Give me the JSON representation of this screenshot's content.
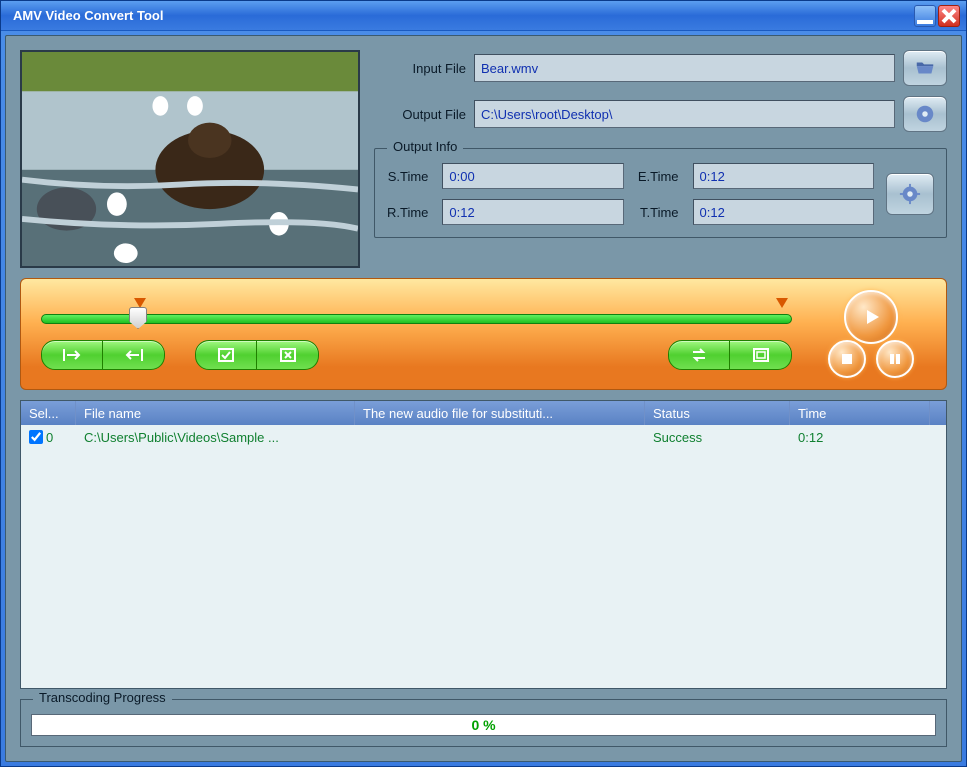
{
  "window": {
    "title": "AMV Video Convert Tool"
  },
  "input": {
    "label": "Input File",
    "value": "Bear.wmv"
  },
  "output": {
    "label": "Output File",
    "value": "C:\\Users\\root\\Desktop\\"
  },
  "outputInfo": {
    "legend": "Output Info",
    "stime": {
      "label": "S.Time",
      "value": "0:00"
    },
    "etime": {
      "label": "E.Time",
      "value": "0:12"
    },
    "rtime": {
      "label": "R.Time",
      "value": "0:12"
    },
    "ttime": {
      "label": "T.Time",
      "value": "0:12"
    }
  },
  "table": {
    "headers": {
      "sel": "Sel...",
      "name": "File name",
      "audio": "The new audio file for substituti...",
      "status": "Status",
      "time": "Time"
    },
    "rows": [
      {
        "checked": true,
        "index": "0",
        "name": "C:\\Users\\Public\\Videos\\Sample ...",
        "audio": "",
        "status": "Success",
        "time": "0:12"
      }
    ]
  },
  "progress": {
    "legend": "Transcoding Progress",
    "text": "0 %"
  }
}
